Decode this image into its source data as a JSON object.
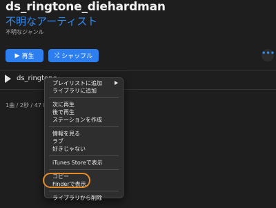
{
  "header": {
    "album_title": "ds_ringtone_diehardman",
    "artist": "不明なアーティスト",
    "genre": "不明なジャンル"
  },
  "actions": {
    "play_label": "再生",
    "shuffle_label": "シャッフル",
    "more_label": "•••"
  },
  "track": {
    "name": "ds_ringtone_diehardman",
    "info": "1曲 / 2秒 / 47 KB"
  },
  "context_menu": {
    "groups": [
      [
        "プレイリストに追加",
        "ライブラリに追加"
      ],
      [
        "次に再生",
        "後で再生",
        "ステーションを作成"
      ],
      [
        "情報を見る",
        "ラブ",
        "好きじゃない"
      ],
      [
        "iTunes Storeで表示"
      ],
      [
        "コピー",
        "Finderで表示"
      ],
      [
        "ライブラリから削除"
      ]
    ]
  },
  "colors": {
    "accent": "#2f8cf5",
    "button": "#2d7ff0",
    "highlight_ring": "#e58c2a"
  }
}
